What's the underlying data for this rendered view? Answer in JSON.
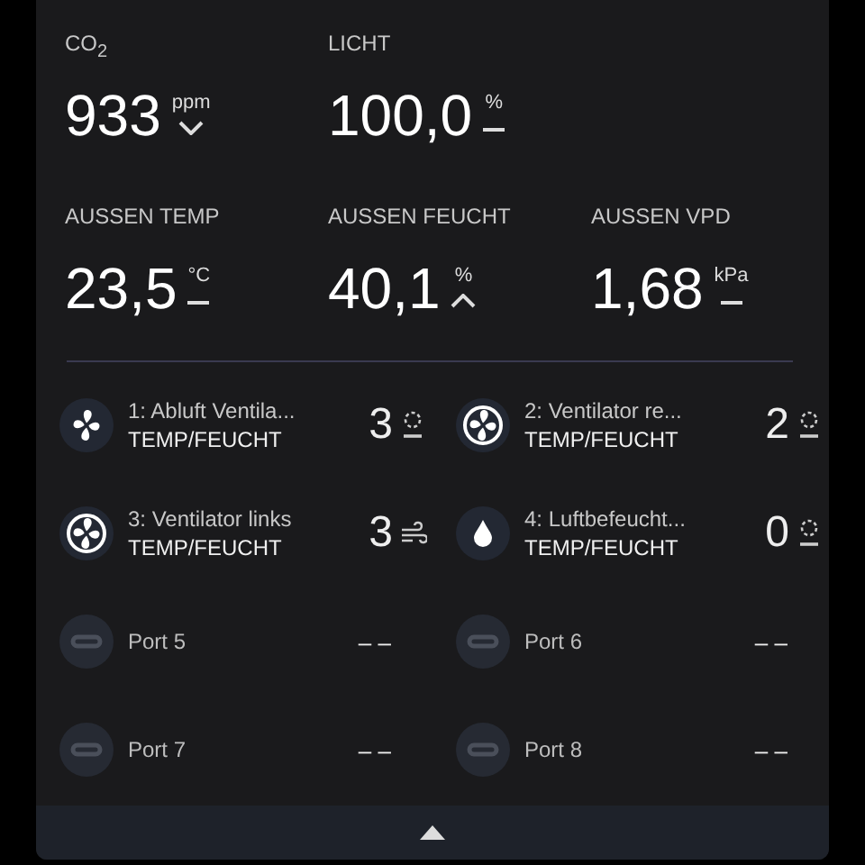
{
  "metrics": [
    {
      "label": "CO$_{2}$",
      "value": "933",
      "unit": "ppm",
      "trend": {
        "kind": "down"
      }
    },
    {
      "label": "LICHT",
      "value": "100,0",
      "unit": "%",
      "trend": {
        "kind": "flat"
      }
    },
    {
      "label": "AUSSEN TEMP",
      "value": "23,5",
      "unit": "°C",
      "trend": {
        "kind": "flat"
      }
    },
    {
      "label": "AUSSEN FEUCHT",
      "value": "40,1",
      "unit": "%",
      "trend": {
        "kind": "up"
      }
    },
    {
      "label": "AUSSEN VPD",
      "value": "1,68",
      "unit": "kPa",
      "trend": {
        "kind": "flat"
      }
    }
  ],
  "devices": [
    {
      "kind": "fan",
      "name": "1: Abluft Ventila...",
      "mode": "TEMP/FEUCHT",
      "reading": "3",
      "status": {
        "kind": "auto"
      }
    },
    {
      "kind": "fan-ring",
      "name": "2: Ventilator re...",
      "mode": "TEMP/FEUCHT",
      "reading": "2",
      "status": {
        "kind": "auto"
      }
    },
    {
      "kind": "fan-ring",
      "name": "3: Ventilator links",
      "mode": "TEMP/FEUCHT",
      "reading": "3",
      "status": {
        "kind": "wind"
      }
    },
    {
      "kind": "drop",
      "name": "4: Luftbefeucht...",
      "mode": "TEMP/FEUCHT",
      "reading": "0",
      "status": {
        "kind": "auto"
      }
    },
    {
      "kind": "port",
      "name": "Port 5",
      "reading": "– –"
    },
    {
      "kind": "port",
      "name": "Port 6",
      "reading": "– –"
    },
    {
      "kind": "port",
      "name": "Port 7",
      "reading": "– –"
    },
    {
      "kind": "port",
      "name": "Port 8",
      "reading": "– –"
    }
  ],
  "footer": {
    "expanded": false
  }
}
